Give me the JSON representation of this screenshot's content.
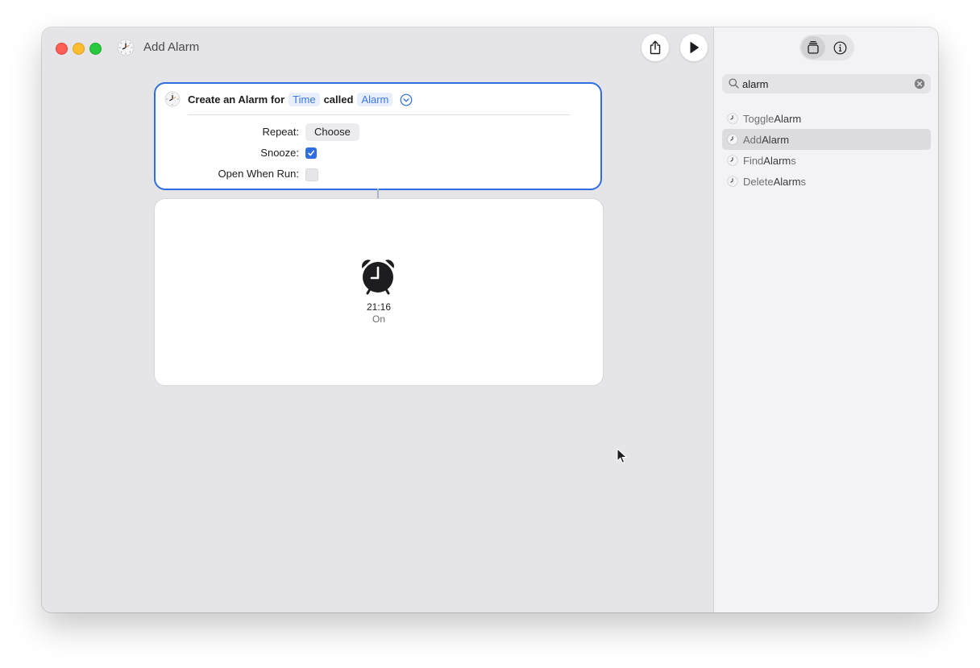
{
  "window": {
    "title": "Add Alarm"
  },
  "toolbar": {
    "share_icon": "share-icon",
    "run_icon": "play-icon"
  },
  "action": {
    "prefix": "Create an Alarm for",
    "time_token": "Time",
    "called": "called",
    "name_token": "Alarm",
    "params": {
      "repeat_label": "Repeat:",
      "repeat_value": "Choose",
      "snooze_label": "Snooze:",
      "snooze_checked": true,
      "open_label": "Open When Run:",
      "open_checked": false
    }
  },
  "result": {
    "time": "21:16",
    "status": "On"
  },
  "sidebar": {
    "search": {
      "value": "alarm",
      "placeholder": "Search"
    },
    "items": [
      {
        "pre": "Toggle ",
        "match": "Alarm",
        "post": "",
        "selected": false
      },
      {
        "pre": "Add ",
        "match": "Alarm",
        "post": "",
        "selected": true
      },
      {
        "pre": "Find ",
        "match": "Alarm",
        "post": "s",
        "selected": false
      },
      {
        "pre": "Delete ",
        "match": "Alarm",
        "post": "s",
        "selected": false
      }
    ]
  },
  "colors": {
    "accent": "#2f6ee0",
    "token_bg": "#e8eefb",
    "token_text": "#3b78e7"
  }
}
